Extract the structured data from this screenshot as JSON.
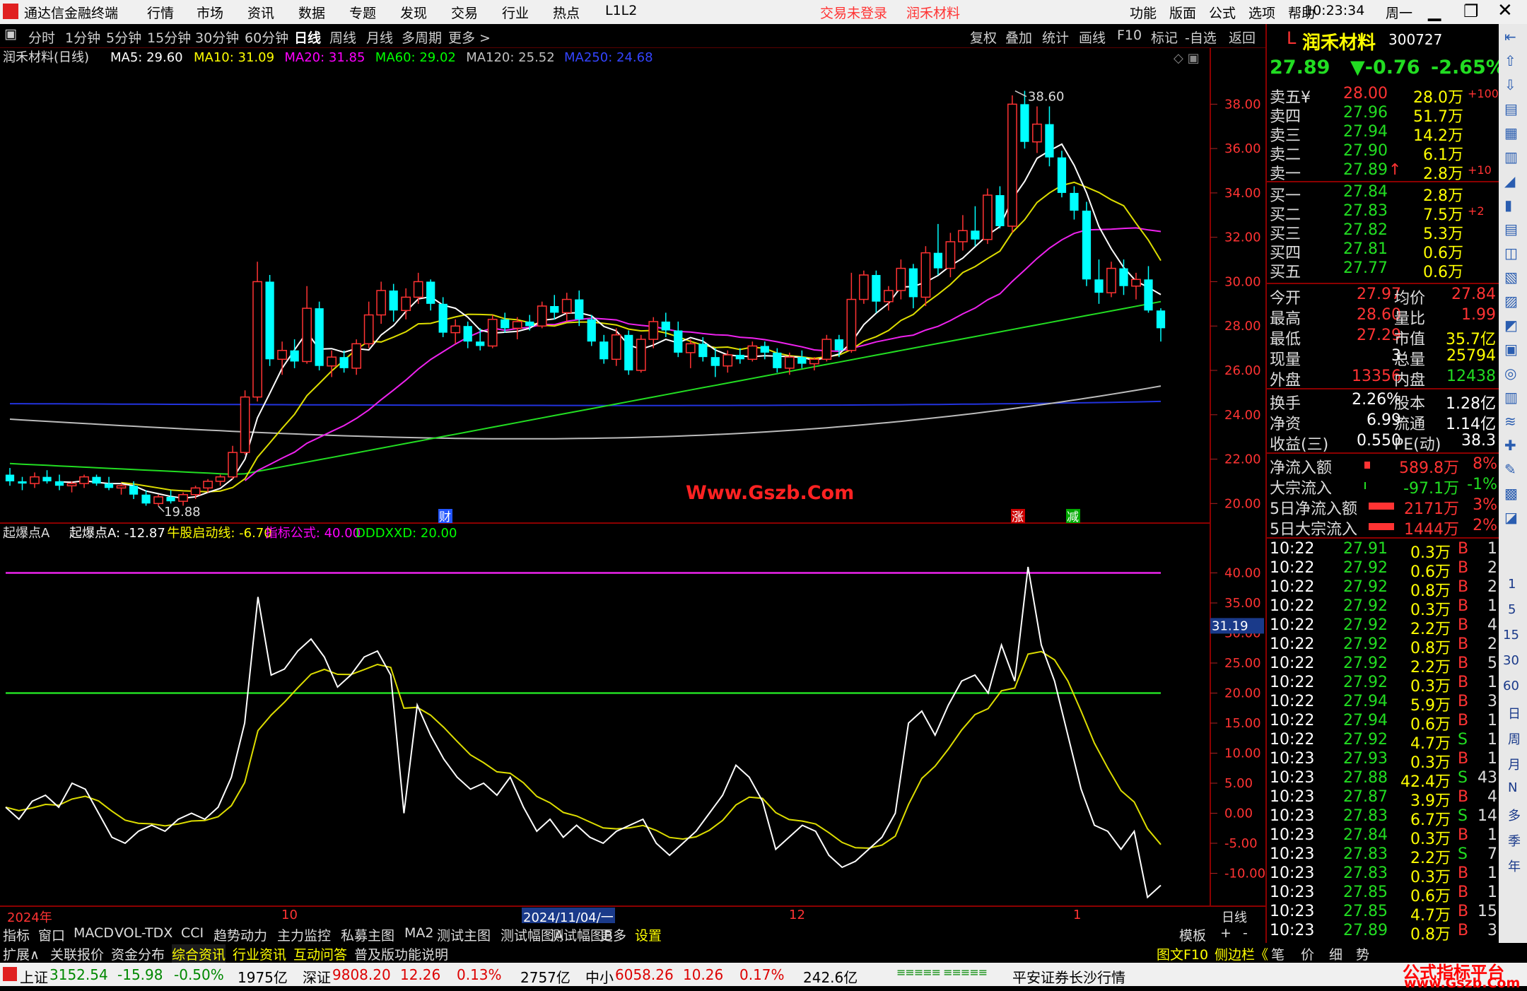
{
  "titlebar": {
    "app": "通达信金融终端",
    "menus": [
      "行情",
      "市场",
      "资讯",
      "数据",
      "专题",
      "发现",
      "交易",
      "行业",
      "热点",
      "L1L2"
    ],
    "status_left": "交易未登录",
    "stock_name": "润禾材料",
    "right_menus": [
      "功能",
      "版面",
      "公式",
      "选项",
      "帮助"
    ],
    "time": "10:23:34",
    "weekday": "周一"
  },
  "toolbar": {
    "periods": [
      "分时",
      "1分钟",
      "5分钟",
      "15分钟",
      "30分钟",
      "60分钟",
      "日线",
      "周线",
      "月线",
      "多周期",
      "更多 >"
    ],
    "active_period": "日线",
    "actions": [
      "复权",
      "叠加",
      "统计",
      "画线",
      "F10",
      "标记",
      "-自选",
      "返回"
    ]
  },
  "ma_legend": {
    "title": "润禾材料(日线)",
    "items": [
      {
        "label": "MA5: 29.60",
        "color": "#ffffff"
      },
      {
        "label": "MA10: 31.09",
        "color": "#ffff00"
      },
      {
        "label": "MA20: 31.85",
        "color": "#ff00ff"
      },
      {
        "label": "MA60: 29.02",
        "color": "#00ff00"
      },
      {
        "label": "MA120: 25.52",
        "color": "#c0c0c0"
      },
      {
        "label": "MA250: 24.68",
        "color": "#3344ff"
      }
    ]
  },
  "price_axis": [
    "38.00",
    "36.00",
    "34.00",
    "32.00",
    "30.00",
    "28.00",
    "26.00",
    "24.00",
    "22.00",
    "20.00"
  ],
  "annotations": {
    "high": "38.60",
    "low": "19.88",
    "watermark": "Www.Gszb.Com",
    "badges": [
      "财",
      "涨",
      "减"
    ]
  },
  "indicator_legend": {
    "title": "起爆点A",
    "items": [
      {
        "label": "起爆点A: -12.87",
        "color": "#ffffff"
      },
      {
        "label": "牛股启动线: -6.70",
        "color": "#ffff00"
      },
      {
        "label": "指标公式: 40.00",
        "color": "#ff00ff"
      },
      {
        "label": "DDDXXD: 20.00",
        "color": "#00ff00"
      }
    ]
  },
  "indicator_axis": [
    "40.00",
    "35.00",
    "30.00",
    "25.00",
    "20.00",
    "15.00",
    "10.00",
    "5.00",
    "0.00",
    "-5.00",
    "-10.00"
  ],
  "indicator_marker": "31.19",
  "date_axis": {
    "labels": [
      "2024年",
      "10",
      "2024/11/04/一",
      "12",
      "1"
    ],
    "right": "日线"
  },
  "bottom_tabs1": [
    "指标",
    "窗口",
    "MACD",
    "VOL-TDX",
    "CCI",
    "趋势动力",
    "主力监控",
    "私募主图",
    "MA2",
    "测试主图",
    "测试幅图A",
    "测试幅图B",
    "更多",
    "设置"
  ],
  "bottom_tabs1_right": [
    "模板",
    "+",
    "-"
  ],
  "bottom_tabs2": [
    "扩展∧",
    "关联报价",
    "资金分布",
    "综合资讯",
    "行业资讯",
    "互动问答",
    "普及版功能说明"
  ],
  "bottom_tabs2_right": [
    "图文F10",
    "侧边栏《",
    "笔",
    "价",
    "细",
    "势"
  ],
  "quote": {
    "code": "300727",
    "name": "润禾材料",
    "price": "27.89",
    "change": "▼-0.76",
    "pct": "-2.65%",
    "asks": [
      {
        "label": "卖五",
        "price": "28.00",
        "vol": "28.0万",
        "extra": "+100"
      },
      {
        "label": "卖四",
        "price": "27.96",
        "vol": "51.7万",
        "extra": ""
      },
      {
        "label": "卖三",
        "price": "27.94",
        "vol": "14.2万",
        "extra": ""
      },
      {
        "label": "卖二",
        "price": "27.90",
        "vol": "6.1万",
        "extra": ""
      },
      {
        "label": "卖一",
        "price": "27.89",
        "vol": "2.8万",
        "extra": "+10"
      }
    ],
    "bids": [
      {
        "label": "买一",
        "price": "27.84",
        "vol": "2.8万",
        "extra": ""
      },
      {
        "label": "买二",
        "price": "27.83",
        "vol": "7.5万",
        "extra": "+2"
      },
      {
        "label": "买三",
        "price": "27.82",
        "vol": "5.3万",
        "extra": ""
      },
      {
        "label": "买四",
        "price": "27.81",
        "vol": "0.6万",
        "extra": ""
      },
      {
        "label": "买五",
        "price": "27.77",
        "vol": "0.6万",
        "extra": ""
      }
    ],
    "stats1": [
      [
        "今开",
        "27.97",
        "均价",
        "27.84"
      ],
      [
        "最高",
        "28.60",
        "量比",
        "1.99"
      ],
      [
        "最低",
        "27.29",
        "市值",
        "35.7亿"
      ],
      [
        "现量",
        "3",
        "总量",
        "25794"
      ],
      [
        "外盘",
        "13356",
        "内盘",
        "12438"
      ]
    ],
    "stats2": [
      [
        "换手",
        "2.26%",
        "股本",
        "1.28亿"
      ],
      [
        "净资",
        "6.99",
        "流通",
        "1.14亿"
      ],
      [
        "收益(三)",
        "0.550",
        "PE(动)",
        "38.3"
      ]
    ],
    "flows": [
      [
        "净流入额",
        "589.8万",
        "8%"
      ],
      [
        "大宗流入",
        "-97.1万",
        "-1%"
      ],
      [
        "5日净流入额",
        "2171万",
        "3%"
      ],
      [
        "5日大宗流入",
        "1444万",
        "2%"
      ]
    ],
    "ticks": [
      [
        "10:22",
        "27.91",
        "0.3万",
        "B",
        "1"
      ],
      [
        "10:22",
        "27.92",
        "0.6万",
        "B",
        "2"
      ],
      [
        "10:22",
        "27.92",
        "0.8万",
        "B",
        "2"
      ],
      [
        "10:22",
        "27.92",
        "0.3万",
        "B",
        "1"
      ],
      [
        "10:22",
        "27.92",
        "2.2万",
        "B",
        "4"
      ],
      [
        "10:22",
        "27.92",
        "0.8万",
        "B",
        "2"
      ],
      [
        "10:22",
        "27.92",
        "2.2万",
        "B",
        "5"
      ],
      [
        "10:22",
        "27.92",
        "0.3万",
        "B",
        "1"
      ],
      [
        "10:22",
        "27.94",
        "5.9万",
        "B",
        "3"
      ],
      [
        "10:22",
        "27.94",
        "0.6万",
        "B",
        "1"
      ],
      [
        "10:22",
        "27.92",
        "4.7万",
        "S",
        "1"
      ],
      [
        "10:23",
        "27.93",
        "0.3万",
        "B",
        "1"
      ],
      [
        "10:23",
        "27.88",
        "42.4万",
        "S",
        "43"
      ],
      [
        "10:23",
        "27.87",
        "3.9万",
        "B",
        "4"
      ],
      [
        "10:23",
        "27.83",
        "6.7万",
        "S",
        "14"
      ],
      [
        "10:23",
        "27.84",
        "0.3万",
        "B",
        "1"
      ],
      [
        "10:23",
        "27.83",
        "2.2万",
        "S",
        "7"
      ],
      [
        "10:23",
        "27.83",
        "0.3万",
        "B",
        "1"
      ],
      [
        "10:23",
        "27.85",
        "0.6万",
        "B",
        "1"
      ],
      [
        "10:23",
        "27.85",
        "4.7万",
        "B",
        "15"
      ],
      [
        "10:23",
        "27.89",
        "0.8万",
        "B",
        "3"
      ]
    ]
  },
  "statusbar": {
    "indices": [
      {
        "name": "上证",
        "value": "3152.54",
        "chg": "-15.98",
        "pct": "-0.50%",
        "amt": "1975亿"
      },
      {
        "name": "深证",
        "value": "9808.20",
        "chg": "12.26",
        "pct": "0.13%",
        "amt": "2757亿"
      },
      {
        "name": "中小",
        "value": "6058.26",
        "chg": "10.26",
        "pct": "0.17%",
        "amt": "242.6亿"
      }
    ],
    "broker": "平安证券长沙行情",
    "brand": "公式指标平台",
    "brand_url": "www.Gszb.Com"
  },
  "right_icons": [
    "1",
    "5",
    "15",
    "30",
    "60",
    "日",
    "周",
    "月",
    "N",
    "多",
    "季",
    "年"
  ],
  "chart_data": {
    "type": "candlestick",
    "y_range": [
      19.5,
      39.0
    ],
    "candles": [
      [
        21.3,
        21.6,
        20.8,
        21.0
      ],
      [
        21.0,
        21.2,
        20.6,
        20.9
      ],
      [
        20.9,
        21.4,
        20.7,
        21.2
      ],
      [
        21.2,
        21.5,
        20.9,
        21.0
      ],
      [
        21.0,
        21.3,
        20.6,
        20.8
      ],
      [
        20.8,
        21.0,
        20.5,
        20.9
      ],
      [
        20.9,
        21.3,
        20.7,
        21.2
      ],
      [
        21.2,
        21.3,
        20.8,
        20.9
      ],
      [
        20.9,
        21.2,
        20.6,
        20.7
      ],
      [
        20.7,
        20.9,
        20.4,
        20.8
      ],
      [
        20.8,
        21.0,
        20.2,
        20.4
      ],
      [
        20.4,
        20.6,
        19.9,
        20.0
      ],
      [
        20.0,
        20.4,
        19.88,
        20.3
      ],
      [
        20.3,
        20.6,
        20.0,
        20.1
      ],
      [
        20.1,
        20.5,
        19.9,
        20.4
      ],
      [
        20.4,
        20.8,
        20.2,
        20.7
      ],
      [
        20.7,
        21.1,
        20.5,
        21.0
      ],
      [
        21.0,
        21.3,
        20.8,
        21.2
      ],
      [
        21.2,
        22.6,
        21.1,
        22.3
      ],
      [
        22.3,
        25.1,
        22.2,
        24.8
      ],
      [
        24.8,
        30.9,
        24.6,
        30.0
      ],
      [
        30.0,
        30.3,
        26.2,
        26.5
      ],
      [
        26.5,
        27.3,
        25.8,
        26.9
      ],
      [
        26.9,
        27.4,
        26.1,
        26.4
      ],
      [
        26.4,
        29.8,
        26.3,
        28.8
      ],
      [
        28.8,
        29.1,
        26.0,
        26.2
      ],
      [
        26.2,
        26.9,
        25.7,
        26.6
      ],
      [
        26.6,
        26.9,
        25.9,
        26.1
      ],
      [
        26.1,
        27.4,
        25.8,
        27.2
      ],
      [
        27.2,
        29.1,
        27.0,
        28.5
      ],
      [
        28.5,
        30.0,
        28.1,
        29.6
      ],
      [
        29.6,
        29.9,
        28.2,
        28.7
      ],
      [
        28.7,
        29.7,
        28.3,
        29.3
      ],
      [
        29.3,
        30.4,
        29.0,
        30.0
      ],
      [
        30.0,
        30.1,
        28.7,
        29.0
      ],
      [
        29.0,
        29.3,
        27.5,
        27.7
      ],
      [
        27.7,
        28.3,
        27.2,
        28.0
      ],
      [
        28.0,
        28.2,
        27.0,
        27.3
      ],
      [
        27.3,
        27.9,
        26.9,
        27.1
      ],
      [
        27.1,
        28.5,
        27.0,
        28.3
      ],
      [
        28.3,
        28.6,
        27.7,
        27.9
      ],
      [
        27.9,
        28.4,
        27.4,
        28.2
      ],
      [
        28.2,
        28.5,
        27.8,
        28.0
      ],
      [
        28.0,
        29.1,
        27.9,
        28.9
      ],
      [
        28.9,
        29.4,
        28.3,
        28.6
      ],
      [
        28.6,
        29.5,
        28.2,
        29.2
      ],
      [
        29.2,
        29.6,
        28.0,
        28.3
      ],
      [
        28.3,
        28.5,
        27.1,
        27.3
      ],
      [
        27.3,
        27.6,
        26.3,
        26.5
      ],
      [
        26.5,
        27.9,
        26.2,
        27.6
      ],
      [
        27.6,
        27.8,
        25.8,
        26.0
      ],
      [
        26.0,
        27.6,
        25.9,
        27.4
      ],
      [
        27.4,
        28.4,
        27.0,
        28.2
      ],
      [
        28.2,
        28.6,
        27.5,
        27.8
      ],
      [
        27.8,
        28.2,
        26.6,
        26.8
      ],
      [
        26.8,
        27.4,
        26.1,
        27.2
      ],
      [
        27.2,
        27.5,
        26.4,
        26.6
      ],
      [
        26.6,
        27.0,
        25.7,
        26.2
      ],
      [
        26.2,
        26.9,
        25.9,
        26.7
      ],
      [
        26.7,
        27.0,
        26.3,
        26.5
      ],
      [
        26.5,
        27.3,
        26.4,
        27.1
      ],
      [
        27.1,
        27.3,
        26.5,
        26.8
      ],
      [
        26.8,
        27.0,
        25.9,
        26.1
      ],
      [
        26.1,
        26.8,
        25.8,
        26.6
      ],
      [
        26.6,
        26.9,
        26.1,
        26.3
      ],
      [
        26.3,
        26.6,
        26.0,
        26.5
      ],
      [
        26.5,
        27.6,
        26.4,
        27.4
      ],
      [
        27.4,
        27.6,
        26.6,
        26.9
      ],
      [
        26.9,
        30.4,
        26.8,
        29.2
      ],
      [
        29.2,
        30.5,
        29.0,
        30.3
      ],
      [
        30.3,
        30.5,
        28.6,
        29.1
      ],
      [
        29.1,
        29.8,
        28.7,
        29.6
      ],
      [
        29.6,
        31.0,
        29.2,
        30.6
      ],
      [
        30.6,
        30.8,
        28.8,
        29.3
      ],
      [
        29.3,
        31.6,
        28.9,
        31.3
      ],
      [
        31.3,
        32.6,
        30.3,
        30.6
      ],
      [
        30.6,
        32.2,
        30.2,
        31.8
      ],
      [
        31.8,
        33.0,
        31.4,
        32.3
      ],
      [
        32.3,
        33.4,
        31.6,
        31.9
      ],
      [
        31.9,
        34.2,
        31.7,
        33.9
      ],
      [
        33.9,
        34.3,
        32.4,
        32.5
      ],
      [
        32.5,
        38.4,
        32.2,
        38.0
      ],
      [
        38.0,
        38.6,
        36.0,
        36.3
      ],
      [
        36.3,
        37.9,
        35.8,
        37.1
      ],
      [
        37.1,
        37.9,
        35.2,
        35.6
      ],
      [
        35.6,
        35.9,
        33.8,
        34.0
      ],
      [
        34.0,
        34.3,
        32.8,
        33.2
      ],
      [
        33.2,
        33.6,
        29.8,
        30.1
      ],
      [
        30.1,
        31.0,
        29.0,
        29.5
      ],
      [
        29.5,
        30.9,
        29.3,
        30.6
      ],
      [
        30.6,
        31.0,
        29.4,
        29.8
      ],
      [
        29.8,
        30.4,
        29.2,
        30.1
      ],
      [
        30.1,
        30.7,
        28.6,
        28.7
      ],
      [
        28.7,
        28.8,
        27.3,
        27.9
      ]
    ],
    "indicator_range": [
      -15,
      45
    ],
    "indicator_white": [
      1,
      -1,
      2,
      3,
      1,
      5,
      4,
      0,
      -4,
      -5,
      -3,
      -2,
      -3,
      -1,
      0,
      -1,
      1,
      6,
      15,
      36,
      23,
      24,
      27,
      29,
      26,
      21,
      23,
      26,
      27,
      23,
      0,
      18,
      13,
      9,
      6,
      4,
      5,
      3,
      6,
      1,
      -3,
      -1,
      -4,
      -2,
      -4,
      -5,
      -3,
      -2,
      -1,
      -5,
      -7,
      -5,
      -3,
      0,
      3,
      8,
      6,
      2,
      -6,
      -4,
      -2,
      -3,
      -7,
      -9,
      -8,
      -6,
      -4,
      0,
      15,
      17,
      13,
      18,
      22,
      23,
      20,
      28,
      22,
      41,
      28,
      22,
      13,
      4,
      -2,
      -3,
      -6,
      -3,
      -14,
      -12
    ]
  }
}
